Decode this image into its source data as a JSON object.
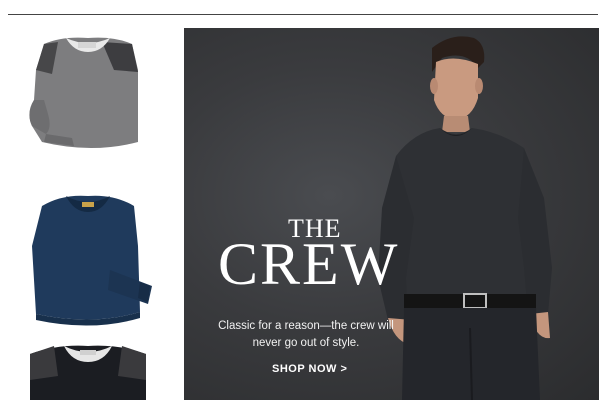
{
  "hero": {
    "eyebrow": "THE",
    "headline": "CREW",
    "tagline": "Classic for a reason—the crew will never go out of style.",
    "cta_label": "SHOP NOW >"
  },
  "products": [
    {
      "icon": "gray-sweater-with-elbow-patches",
      "color": "#808080"
    },
    {
      "icon": "navy-crewneck-sweater",
      "color": "#1f3a5c"
    },
    {
      "icon": "black-sweater-with-shoulder-patches",
      "color": "#1b1d22"
    }
  ],
  "colors": {
    "hero_background": "#3a3b3e",
    "hero_text": "#ffffff",
    "rule": "#444444"
  }
}
